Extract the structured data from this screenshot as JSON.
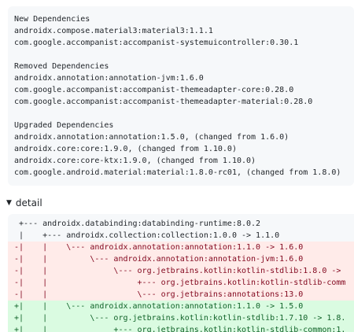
{
  "summary_block": {
    "new_heading": "New Dependencies",
    "new_items": [
      "androidx.compose.material3:material3:1.1.1",
      "com.google.accompanist:accompanist-systemuicontroller:0.30.1"
    ],
    "removed_heading": "Removed Dependencies",
    "removed_items": [
      "androidx.annotation:annotation-jvm:1.6.0",
      "com.google.accompanist:accompanist-themeadapter-core:0.28.0",
      "com.google.accompanist:accompanist-themeadapter-material:0.28.0"
    ],
    "upgraded_heading": "Upgraded Dependencies",
    "upgraded_items": [
      "androidx.annotation:annotation:1.5.0, (changed from 1.6.0)",
      "androidx.core:core:1.9.0, (changed from 1.10.0)",
      "androidx.core:core-ktx:1.9.0, (changed from 1.10.0)",
      "com.google.android.material:material:1.8.0-rc01, (changed from 1.8.0)"
    ]
  },
  "details": {
    "label": "detail",
    "triangle": "▼"
  },
  "diff": {
    "lines": [
      {
        "kind": "ctx",
        "text": " +--- androidx.databinding:databinding-runtime:8.0.2"
      },
      {
        "kind": "ctx",
        "text": " |    +--- androidx.collection:collection:1.0.0 -> 1.1.0"
      },
      {
        "kind": "del",
        "text": "-|    |    \\--- androidx.annotation:annotation:1.1.0 -> 1.6.0"
      },
      {
        "kind": "del",
        "text": "-|    |         \\--- androidx.annotation:annotation-jvm:1.6.0"
      },
      {
        "kind": "del",
        "text": "-|    |              \\--- org.jetbrains.kotlin:kotlin-stdlib:1.8.0 ->"
      },
      {
        "kind": "del",
        "text": "-|    |                   +--- org.jetbrains.kotlin:kotlin-stdlib-comm"
      },
      {
        "kind": "del",
        "text": "-|    |                   \\--- org.jetbrains:annotations:13.0"
      },
      {
        "kind": "add",
        "text": "+|    |    \\--- androidx.annotation:annotation:1.1.0 -> 1.5.0"
      },
      {
        "kind": "add",
        "text": "+|    |         \\--- org.jetbrains.kotlin:kotlin-stdlib:1.7.10 -> 1.8."
      },
      {
        "kind": "add",
        "text": "+|    |              +--- org.jetbrains.kotlin:kotlin-stdlib-common:1."
      }
    ]
  }
}
